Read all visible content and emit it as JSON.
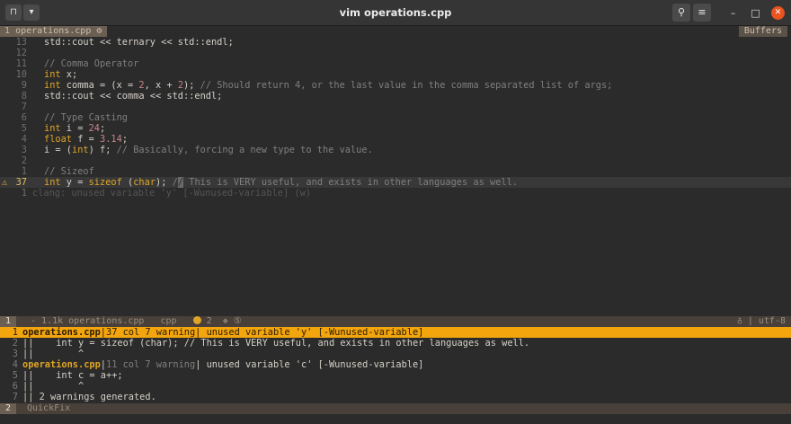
{
  "window": {
    "title": "vim operations.cpp",
    "left_buttons": [
      {
        "name": "terminal-tab-icon",
        "glyph": "⊓"
      },
      {
        "name": "dropdown-icon",
        "glyph": "▾"
      }
    ],
    "right_tools": [
      {
        "name": "search-icon",
        "glyph": "⚲"
      },
      {
        "name": "menu-icon",
        "glyph": "≡"
      }
    ],
    "controls": {
      "minimize": "–",
      "maximize": "□",
      "close": "✕"
    }
  },
  "tabline": {
    "tab_number": "1",
    "tab_name": "operations.cpp",
    "tab_icon": "⚙",
    "buffers_label": "Buffers"
  },
  "editor": {
    "lines": [
      {
        "ln": "13",
        "tokens": [
          {
            "t": "std::cout << ternary << std::endl;",
            "c": ""
          }
        ]
      },
      {
        "ln": "12",
        "tokens": []
      },
      {
        "ln": "11",
        "tokens": [
          {
            "t": "// Comma Operator",
            "c": "cm"
          }
        ]
      },
      {
        "ln": "10",
        "tokens": [
          {
            "t": "int",
            "c": "kw"
          },
          {
            "t": " x;",
            "c": ""
          }
        ]
      },
      {
        "ln": "9",
        "tokens": [
          {
            "t": "int",
            "c": "kw"
          },
          {
            "t": " comma = (x = ",
            "c": ""
          },
          {
            "t": "2",
            "c": "num"
          },
          {
            "t": ", x + ",
            "c": ""
          },
          {
            "t": "2",
            "c": "num"
          },
          {
            "t": "); ",
            "c": ""
          },
          {
            "t": "// Should return 4, or the last value in the comma separated list of args;",
            "c": "cm"
          }
        ]
      },
      {
        "ln": "8",
        "tokens": [
          {
            "t": "std::cout << comma << std::endl;",
            "c": ""
          }
        ]
      },
      {
        "ln": "7",
        "tokens": []
      },
      {
        "ln": "6",
        "tokens": [
          {
            "t": "// Type Casting",
            "c": "cm"
          }
        ]
      },
      {
        "ln": "5",
        "tokens": [
          {
            "t": "int",
            "c": "kw"
          },
          {
            "t": " i = ",
            "c": ""
          },
          {
            "t": "24",
            "c": "num"
          },
          {
            "t": ";",
            "c": ""
          }
        ]
      },
      {
        "ln": "4",
        "tokens": [
          {
            "t": "float",
            "c": "kw"
          },
          {
            "t": " f = ",
            "c": ""
          },
          {
            "t": "3.14",
            "c": "num"
          },
          {
            "t": ";",
            "c": ""
          }
        ]
      },
      {
        "ln": "3",
        "tokens": [
          {
            "t": "i = (",
            "c": ""
          },
          {
            "t": "int",
            "c": "kw"
          },
          {
            "t": ") f; ",
            "c": ""
          },
          {
            "t": "// Basically, forcing a new type to the value.",
            "c": "cm"
          }
        ]
      },
      {
        "ln": "2",
        "tokens": []
      },
      {
        "ln": "1",
        "tokens": [
          {
            "t": "// Sizeof",
            "c": "cm"
          }
        ]
      }
    ],
    "current_line": {
      "sign": "⚠",
      "ln": "37",
      "tokens": [
        {
          "t": "int",
          "c": "kw"
        },
        {
          "t": " y = ",
          "c": ""
        },
        {
          "t": "sizeof",
          "c": "kw"
        },
        {
          "t": " (",
          "c": ""
        },
        {
          "t": "char",
          "c": "kw"
        },
        {
          "t": "); ",
          "c": ""
        },
        {
          "t": "/",
          "c": "cm"
        },
        {
          "t": "/",
          "c": "cursor"
        },
        {
          "t": " This is VERY useful, and exists in other languages as well.",
          "c": "cm"
        }
      ]
    },
    "virtual_line": {
      "ln": "1",
      "text": "clang: unused variable 'y' [-Wunused-variable] (w)"
    }
  },
  "statusline": {
    "mode_number": "1",
    "left_text": " - 1.1k operations.cpp   cpp   ",
    "warning_count": "2",
    "extra": "  ❖ ⑤",
    "right_text": "♁ | utf-8"
  },
  "quickfix": {
    "lines": [
      {
        "ln": "1",
        "selected": true,
        "tokens": [
          {
            "t": "operations.cpp",
            "c": "fname"
          },
          {
            "t": "|37 col 7 warning| unused variable 'y' [-Wunused-variable]",
            "c": ""
          }
        ]
      },
      {
        "ln": "2",
        "selected": false,
        "tokens": [
          {
            "t": "||    int y = sizeof (char); // This is VERY useful, and exists in other languages as well.",
            "c": ""
          }
        ]
      },
      {
        "ln": "3",
        "selected": false,
        "tokens": [
          {
            "t": "||        ^",
            "c": ""
          }
        ]
      },
      {
        "ln": "4",
        "selected": false,
        "tokens": [
          {
            "t": "operations.cpp",
            "c": "fname"
          },
          {
            "t": "|",
            "c": ""
          },
          {
            "t": "11 col 7 warning",
            "c": "dim"
          },
          {
            "t": "| unused variable 'c' [-Wunused-variable]",
            "c": ""
          }
        ]
      },
      {
        "ln": "5",
        "selected": false,
        "tokens": [
          {
            "t": "||    int c = a++;",
            "c": ""
          }
        ]
      },
      {
        "ln": "6",
        "selected": false,
        "tokens": [
          {
            "t": "||        ^",
            "c": ""
          }
        ]
      },
      {
        "ln": "7",
        "selected": false,
        "tokens": [
          {
            "t": "|| 2 warnings generated.",
            "c": ""
          }
        ]
      }
    ]
  },
  "quickfix_status": {
    "number": "2",
    "label": "QuickFix"
  },
  "colors": {
    "accent": "#f3a50e",
    "keyword": "#e0a526",
    "number": "#c7858c",
    "comment": "#7f7f7f",
    "close_button": "#e95420"
  }
}
